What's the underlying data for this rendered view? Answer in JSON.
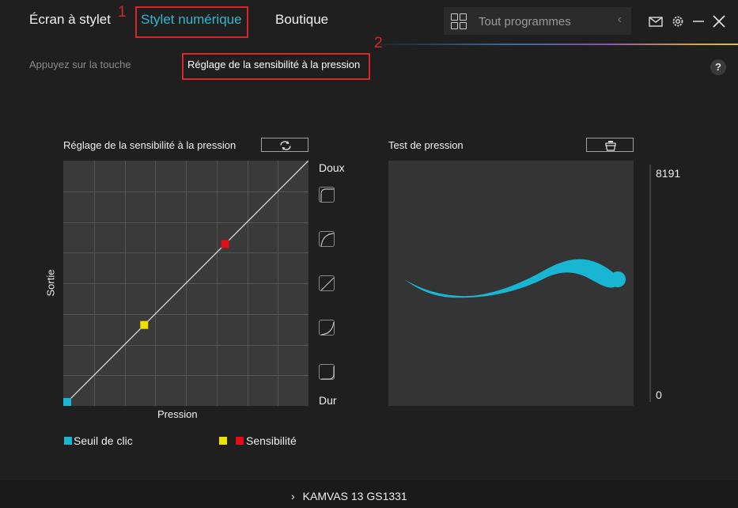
{
  "header": {
    "tabs": [
      {
        "label": "Écran à stylet"
      },
      {
        "label": "Stylet numérique"
      },
      {
        "label": "Boutique"
      }
    ],
    "programs_label": "Tout programmes",
    "annotation_1": "1",
    "annotation_2": "2"
  },
  "subnav": {
    "items": [
      {
        "label": "Appuyez sur la touche"
      },
      {
        "label": "Réglage de la sensibilité à la pression"
      }
    ],
    "help": "?"
  },
  "sensitivity": {
    "title": "Réglage de la sensibilité à la pression",
    "x_label": "Pression",
    "y_label": "Sortie",
    "soft_label": "Doux",
    "hard_label": "Dur",
    "click_threshold": [
      0,
      0
    ],
    "sensitivity_points": [
      [
        0.33,
        0.33
      ],
      [
        0.66,
        0.66
      ]
    ]
  },
  "test": {
    "title": "Test de pression",
    "max_value": "8191",
    "min_value": "0"
  },
  "legend": {
    "threshold_label": "Seuil de clic",
    "sensitivity_label": "Sensibilité"
  },
  "footer": {
    "chevron": "›",
    "device": "KAMVAS 13 GS1331"
  },
  "colors": {
    "accent": "#2fb8d0",
    "annotation": "#d9262a",
    "threshold": "#19b6d3",
    "sensitivity_yellow": "#f0e000",
    "sensitivity_red": "#e0101a",
    "stroke": "#19b6d3"
  }
}
